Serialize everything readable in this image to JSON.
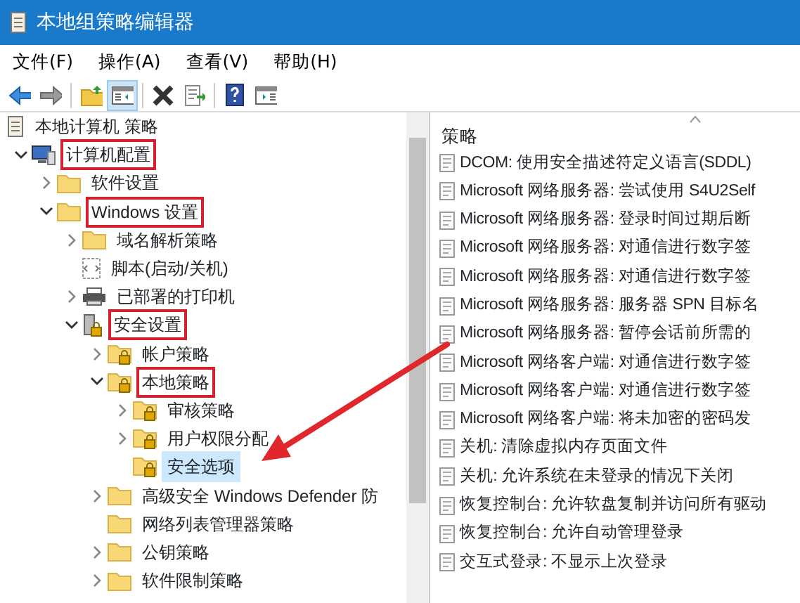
{
  "window": {
    "title": "本地组策略编辑器"
  },
  "menu": [
    "文件(F)",
    "操作(A)",
    "查看(V)",
    "帮助(H)"
  ],
  "toolbar": [
    {
      "kind": "back",
      "pressed": false
    },
    {
      "kind": "forward",
      "pressed": false
    },
    {
      "kind": "sep"
    },
    {
      "kind": "up",
      "pressed": false
    },
    {
      "kind": "pane",
      "pressed": true
    },
    {
      "kind": "sep"
    },
    {
      "kind": "delete",
      "pressed": false
    },
    {
      "kind": "export",
      "pressed": false
    },
    {
      "kind": "sep"
    },
    {
      "kind": "help",
      "pressed": false
    },
    {
      "kind": "props",
      "pressed": false
    }
  ],
  "tree": {
    "label": "本地计算机 策略",
    "kind": "doc",
    "children": [
      {
        "label": "计算机配置",
        "kind": "computer",
        "expanded": true,
        "highlighted": true,
        "selected": false,
        "children": [
          {
            "label": "软件设置",
            "kind": "folder",
            "expanded": false,
            "highlighted": false,
            "selected": false
          },
          {
            "label": "Windows 设置",
            "kind": "folder",
            "expanded": true,
            "highlighted": true,
            "selected": false,
            "children": [
              {
                "label": "域名解析策略",
                "kind": "folder",
                "expanded": false,
                "highlighted": false,
                "selected": false
              },
              {
                "label": "脚本(启动/关机)",
                "kind": "script",
                "highlighted": false,
                "selected": false
              },
              {
                "label": "已部署的打印机",
                "kind": "printer",
                "expanded": false,
                "highlighted": false,
                "selected": false
              },
              {
                "label": "安全设置",
                "kind": "security",
                "expanded": true,
                "highlighted": true,
                "selected": false,
                "children": [
                  {
                    "label": "帐户策略",
                    "kind": "lockfolder",
                    "expanded": false,
                    "highlighted": false,
                    "selected": false
                  },
                  {
                    "label": "本地策略",
                    "kind": "lockfolder",
                    "expanded": true,
                    "highlighted": true,
                    "selected": false,
                    "children": [
                      {
                        "label": "审核策略",
                        "kind": "lockfolder",
                        "expanded": false,
                        "highlighted": false,
                        "selected": false
                      },
                      {
                        "label": "用户权限分配",
                        "kind": "lockfolder",
                        "expanded": false,
                        "highlighted": false,
                        "selected": false
                      },
                      {
                        "label": "安全选项",
                        "kind": "lockfolder",
                        "highlighted": false,
                        "selected": true
                      }
                    ]
                  },
                  {
                    "label": "高级安全 Windows Defender 防",
                    "kind": "folder",
                    "expanded": false,
                    "highlighted": false,
                    "selected": false
                  },
                  {
                    "label": "网络列表管理器策略",
                    "kind": "folder",
                    "highlighted": false,
                    "selected": false
                  },
                  {
                    "label": "公钥策略",
                    "kind": "folder",
                    "expanded": false,
                    "highlighted": false,
                    "selected": false
                  },
                  {
                    "label": "软件限制策略",
                    "kind": "folder",
                    "expanded": false,
                    "highlighted": false,
                    "selected": false
                  }
                ]
              }
            ]
          }
        ]
      }
    ]
  },
  "list": {
    "column": "策略",
    "rows": [
      "DCOM: 使用安全描述符定义语言(SDDL)",
      "Microsoft 网络服务器: 尝试使用 S4U2Self",
      "Microsoft 网络服务器: 登录时间过期后断",
      "Microsoft 网络服务器: 对通信进行数字签",
      "Microsoft 网络服务器: 对通信进行数字签",
      "Microsoft 网络服务器: 服务器 SPN 目标名",
      "Microsoft 网络服务器: 暂停会话前所需的",
      "Microsoft 网络客户端: 对通信进行数字签",
      "Microsoft 网络客户端: 对通信进行数字签",
      "Microsoft 网络客户端: 将未加密的密码发",
      "关机: 清除虚拟内存页面文件",
      "关机: 允许系统在未登录的情况下关闭",
      "恢复控制台: 允许软盘复制并访问所有驱动",
      "恢复控制台: 允许自动管理登录",
      "交互式登录: 不显示上次登录"
    ]
  }
}
